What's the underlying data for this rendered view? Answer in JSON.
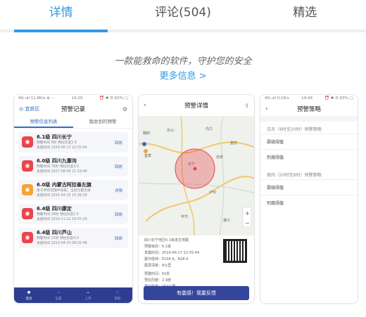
{
  "tabs": [
    {
      "label": "详情"
    },
    {
      "label": "评论(504)"
    },
    {
      "label": "精选"
    }
  ],
  "slogan": "一款能救命的软件，守护您的安全",
  "more_info": "更多信息 >",
  "shot1": {
    "status": {
      "left": "4G.ull 11.8K/s ⊕ ···",
      "time": "14:20",
      "right": "⏰ ✱ ☰ 62% ▢"
    },
    "location": "◎ 宜宾区",
    "title": "预警记录",
    "seg": [
      "预警信息列表",
      "我收到的预警"
    ],
    "cards": [
      {
        "t": "6.1级  四川长宁",
        "s1": "预警时间 6秒  预估烈度2.9",
        "s2": "发震时间 2019-06-17 22:55:44",
        "a": "回放",
        "c": "#e8454d"
      },
      {
        "t": "6.0级  四川九寨沟",
        "s1": "预警时间 78秒  预估烈度2.0",
        "s2": "发震时间 2017-08-08 21:19:48",
        "a": "回放",
        "c": "#e8454d"
      },
      {
        "t": "6.0级  内蒙古阿拉善左旗",
        "s1": "级于所有范围中低级，当前位置无感",
        "s2": "发震时间 2015-04-15 15:39:28",
        "a": "详情",
        "c": "#f3a536"
      },
      {
        "t": "6.4级  四川康定",
        "s1": "预警时间 28秒  预估烈度2.5",
        "s2": "发震时间 2014-11-22 16:55:26",
        "a": "回放",
        "c": "#e8454d"
      },
      {
        "t": "6.4级  四川芦山",
        "s1": "预警时间 23秒  预估烈度4.0",
        "s2": "发震时间 2013-04-20 08:02:46",
        "a": "回放",
        "c": "#e8454d"
      }
    ],
    "bottom": [
      "首页",
      "设置",
      "上传",
      "帮助"
    ]
  },
  "shot2": {
    "title": "预警详情",
    "map_labels": [
      "我的",
      "宜宾",
      "长宁",
      "泸州",
      "乐山",
      "重庆",
      "自贡",
      "遵义",
      "毕节",
      "内江"
    ],
    "info": [
      "四川长宁地区6.1级发生地震",
      "预警级别：6.1级",
      "发震时间：2019-06-17 22:55:44",
      "震中经纬：E104.9，N28.4",
      "震源深度：8公里",
      "预警时间：61秒",
      "预估烈度：2.9度",
      "震中距离：264公里",
      "成都高新减灾研究所"
    ],
    "button": "有震感！我要反馈"
  },
  "shot3": {
    "status": {
      "left": "4G.ull 0.1K/s",
      "time": "14:09",
      "right": "⏰ ✱ ☰ 63% ▢"
    },
    "title": "预警策略",
    "day_section": "白天（8时至20时）预警策略:",
    "day_rows": [
      "震级阈值",
      "烈度阈值"
    ],
    "night_section": "夜间（20时至8时）预警策略:",
    "night_rows": [
      "震级阈值",
      "烈度阈值"
    ]
  }
}
